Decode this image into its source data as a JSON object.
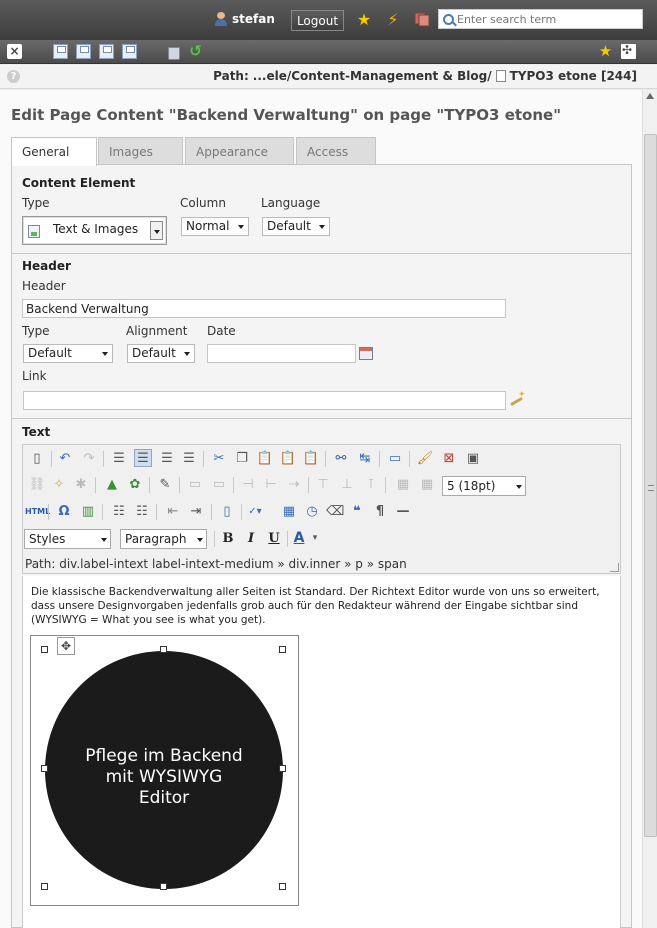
{
  "topbar": {
    "username": "stefan",
    "logout_label": "Logout",
    "search_placeholder": "Enter search term",
    "icons": [
      "user-icon",
      "bookmark-star-icon",
      "flash-icon",
      "workspace-icon",
      "search-icon"
    ]
  },
  "docbar": {
    "icons": [
      "close-icon",
      "save-icon",
      "save-view-icon",
      "save-close-icon",
      "save-new-icon",
      "delete-icon",
      "undo-icon",
      "shortcut-star-icon",
      "fullscreen-icon"
    ]
  },
  "pathbar": {
    "path_label": "Path:",
    "path": "...ele/Content-Management & Blog/",
    "page": "TYPO3 etone [244]"
  },
  "page_title": "Edit Page Content \"Backend Verwaltung\" on page \"TYPO3 etone\"",
  "tabs": [
    {
      "label": "General",
      "active": true
    },
    {
      "label": "Images",
      "active": false
    },
    {
      "label": "Appearance",
      "active": false
    },
    {
      "label": "Access",
      "active": false
    }
  ],
  "content_element": {
    "title": "Content Element",
    "type_label": "Type",
    "type_value": "Text & Images",
    "column_label": "Column",
    "column_value": "Normal",
    "language_label": "Language",
    "language_value": "Default"
  },
  "header_section": {
    "title": "Header",
    "header_label": "Header",
    "header_value": "Backend Verwaltung",
    "type_label": "Type",
    "type_value": "Default",
    "alignment_label": "Alignment",
    "alignment_value": "Default",
    "date_label": "Date",
    "date_value": "",
    "link_label": "Link",
    "link_value": ""
  },
  "text_section": {
    "title": "Text",
    "font_size_value": "5 (18pt)",
    "styles_value": "Styles",
    "block_value": "Paragraph",
    "html_label": "HTML",
    "bold_label": "B",
    "italic_label": "I",
    "underline_label": "U",
    "fontcolor_label": "A",
    "path": "Path: div.label-intext label-intext-medium » div.inner » p » span"
  },
  "editor": {
    "paragraph": "Die klassische Backendverwaltung aller Seiten ist Standard. Der Richtext Editor wurde von uns so erweitert, dass unsere Designvorgaben jedenfalls grob auch für den Redakteur während der Eingabe sichtbar sind (WYSIWYG = What you see is what you get).",
    "image_line1": "Pflege im Backend",
    "image_line2": "mit WYSIWYG",
    "image_line3": "Editor"
  }
}
